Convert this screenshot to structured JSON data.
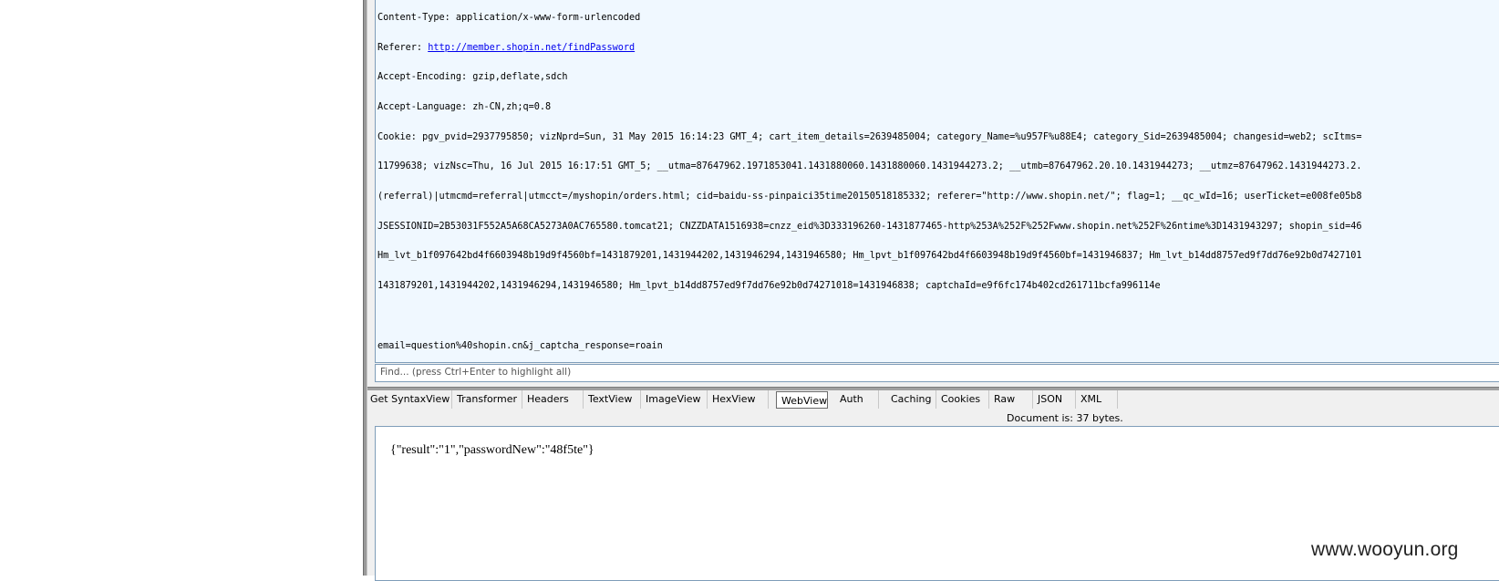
{
  "request": {
    "lines": [
      "Content-Type: application/x-www-form-urlencoded",
      "Accept-Encoding: gzip,deflate,sdch",
      "Accept-Language: zh-CN,zh;q=0.8",
      "Cookie: pgv_pvid=2937795850; vizNprd=Sun, 31 May 2015 16:14:23 GMT_4; cart_item_details=2639485004; category_Name=%u957F%u88E4; category_Sid=2639485004; changesid=web2; scItms=",
      "11799638; vizNsc=Thu, 16 Jul 2015 16:17:51 GMT_5; __utma=87647962.1971853041.1431880060.1431880060.1431944273.2; __utmb=87647962.20.10.1431944273; __utmz=87647962.1431944273.2.",
      "(referral)|utmcmd=referral|utmcct=/myshopin/orders.html; cid=baidu-ss-pinpaici35time20150518185332; referer=\"http://www.shopin.net/\"; flag=1; __qc_wId=16; userTicket=e008fe05b8",
      "JSESSIONID=2B53031F552A5A68CA5273A0AC765580.tomcat21; CNZZDATA1516938=cnzz_eid%3D333196260-1431877465-http%253A%252F%252Fwww.shopin.net%252F%26ntime%3D1431943297; shopin_sid=46",
      "Hm_lvt_b1f097642bd4f6603948b19d9f4560bf=1431879201,1431944202,1431946294,1431946580; Hm_lpvt_b1f097642bd4f6603948b19d9f4560bf=1431946837; Hm_lvt_b14dd8757ed9f7dd76e92b0d7427101",
      "1431879201,1431944202,1431946294,1431946580; Hm_lpvt_b14dd8757ed9f7dd76e92b0d74271018=1431946838; captchaId=e9f6fc174b402cd261711bcfa996114e",
      "",
      "email=question%40shopin.cn&j_captcha_response=roain"
    ],
    "referer_label": "Referer: ",
    "referer_url": "http://member.shopin.net/findPassword"
  },
  "find": {
    "placeholder": "Find... (press Ctrl+Enter to highlight all)"
  },
  "tabs": {
    "items": [
      "Get SyntaxView",
      "Transformer",
      "Headers",
      "TextView",
      "ImageView",
      "HexView",
      "WebView",
      "Auth",
      "Caching",
      "Cookies",
      "Raw",
      "JSON",
      "XML"
    ],
    "selected": "WebView"
  },
  "status": {
    "document": "Document is: 37 bytes."
  },
  "response": {
    "body": "{\"result\":\"1\",\"passwordNew\":\"48f5te\"}"
  },
  "watermark": "www.wooyun.org"
}
